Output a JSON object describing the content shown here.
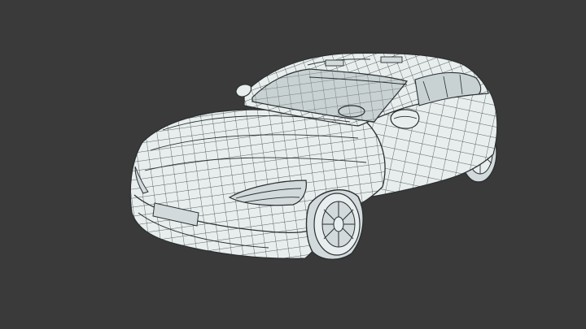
{
  "scene": {
    "subject": "car-wireframe-render",
    "colors": {
      "background": "#3a3a3a",
      "surface": "#e8eeee",
      "surface_shade": "#d2dadb",
      "wire": "#2b2f31",
      "glass": "#c9d2d3"
    }
  }
}
